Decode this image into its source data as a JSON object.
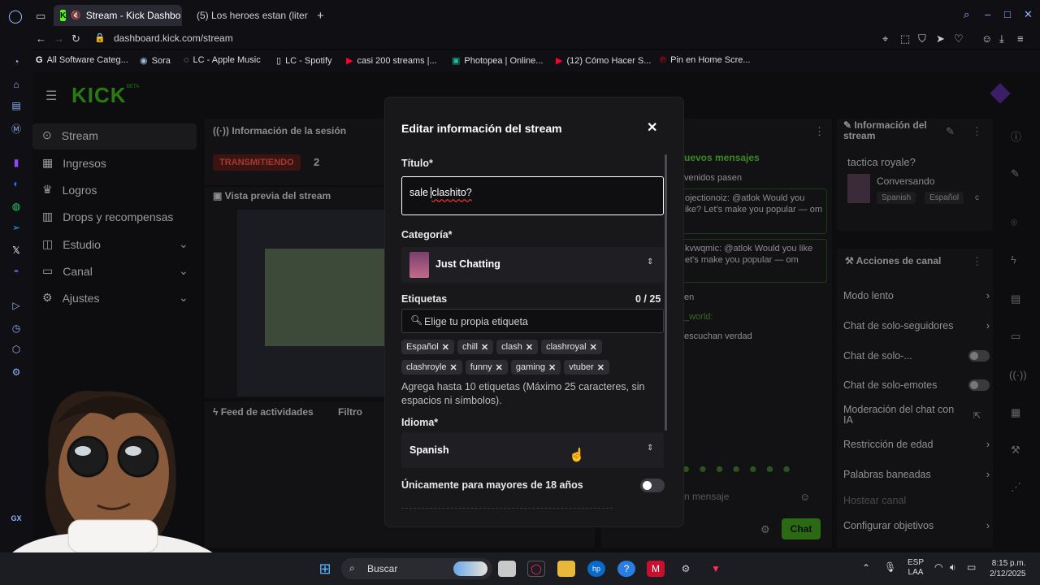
{
  "browser": {
    "tabs": [
      {
        "label": "Stream - Kick Dashbo",
        "active": true
      },
      {
        "label": "(5) Los heroes estan (liter",
        "active": false
      }
    ],
    "url": "dashboard.kick.com/stream",
    "bookmarks": [
      "All Software Categ...",
      "Sora",
      "LC - Apple Music",
      "LC - Spotify",
      "casi 200 streams |...",
      "Photopea | Online...",
      "(12) Cómo Hacer S...",
      "Pin en Home Scre..."
    ],
    "gx_label": "GX"
  },
  "kick": {
    "logo": "KICK",
    "logo_badge": "BETA",
    "nav": [
      {
        "label": "Stream",
        "icon": "stream-icon"
      },
      {
        "label": "Ingresos",
        "icon": "income-icon"
      },
      {
        "label": "Logros",
        "icon": "trophy-icon"
      },
      {
        "label": "Drops y recompensas",
        "icon": "drops-icon"
      },
      {
        "label": "Estudio",
        "icon": "studio-icon",
        "chevron": true
      },
      {
        "label": "Canal",
        "icon": "channel-icon",
        "chevron": true
      },
      {
        "label": "Ajustes",
        "icon": "settings-icon",
        "chevron": true
      }
    ],
    "session": {
      "title": "Información de la sesión",
      "status": "TRANSMITIENDO",
      "viewers": "2"
    },
    "preview_title": "Vista previa del stream",
    "activity": {
      "title": "Feed de actividades",
      "filter": "Filtro"
    },
    "chat": {
      "header": "uevos mensajes",
      "lines": [
        "venidos pasen",
        "ojectionoiz: @atlok Would you ike? Let's make you popular — om",
        "kvwqmic: @atlok Would you like et's make you popular — om",
        "en",
        "_world:",
        "escuchan verdad"
      ],
      "placeholder": "n mensaje",
      "send": "Chat"
    },
    "info": {
      "title": "Información del stream",
      "stream_title": "tactica royale?",
      "category": "Conversando",
      "tags": [
        "Spanish",
        "Español",
        "c"
      ]
    },
    "actions": {
      "title": "Acciones de canal",
      "items": [
        "Modo lento",
        "Chat de solo-seguidores",
        "Chat de solo-...",
        "Chat de solo-emotes",
        "Moderación del chat con IA",
        "Restricción de edad",
        "Palabras baneadas",
        "Hostear canal",
        "Configurar objetivos"
      ]
    }
  },
  "modal": {
    "title": "Editar información del stream",
    "title_label": "Título*",
    "title_value_a": "sale ",
    "title_value_b": "clashito?",
    "category_label": "Categoría*",
    "category_value": "Just Chatting",
    "tags_label": "Etiquetas",
    "tags_count": "0 / 25",
    "tags_placeholder": "Elige tu propia etiqueta",
    "tags": [
      "Español",
      "chill",
      "clash",
      "clashroyal",
      "clashroyle",
      "funny",
      "gaming",
      "vtuber"
    ],
    "tags_help": "Agrega hasta 10 etiquetas (Máximo 25 caracteres, sin espacios ni símbolos).",
    "language_label": "Idioma*",
    "language_value": "Spanish",
    "adult_label": "Únicamente para mayores de 18 años"
  },
  "taskbar": {
    "search": "Buscar",
    "lang": "ESP",
    "lang2": "LAA",
    "time": "8:15 p.m.",
    "date": "2/12/2025"
  },
  "colors": {
    "kick_green": "#53fc18",
    "live_red": "#eb0400"
  }
}
